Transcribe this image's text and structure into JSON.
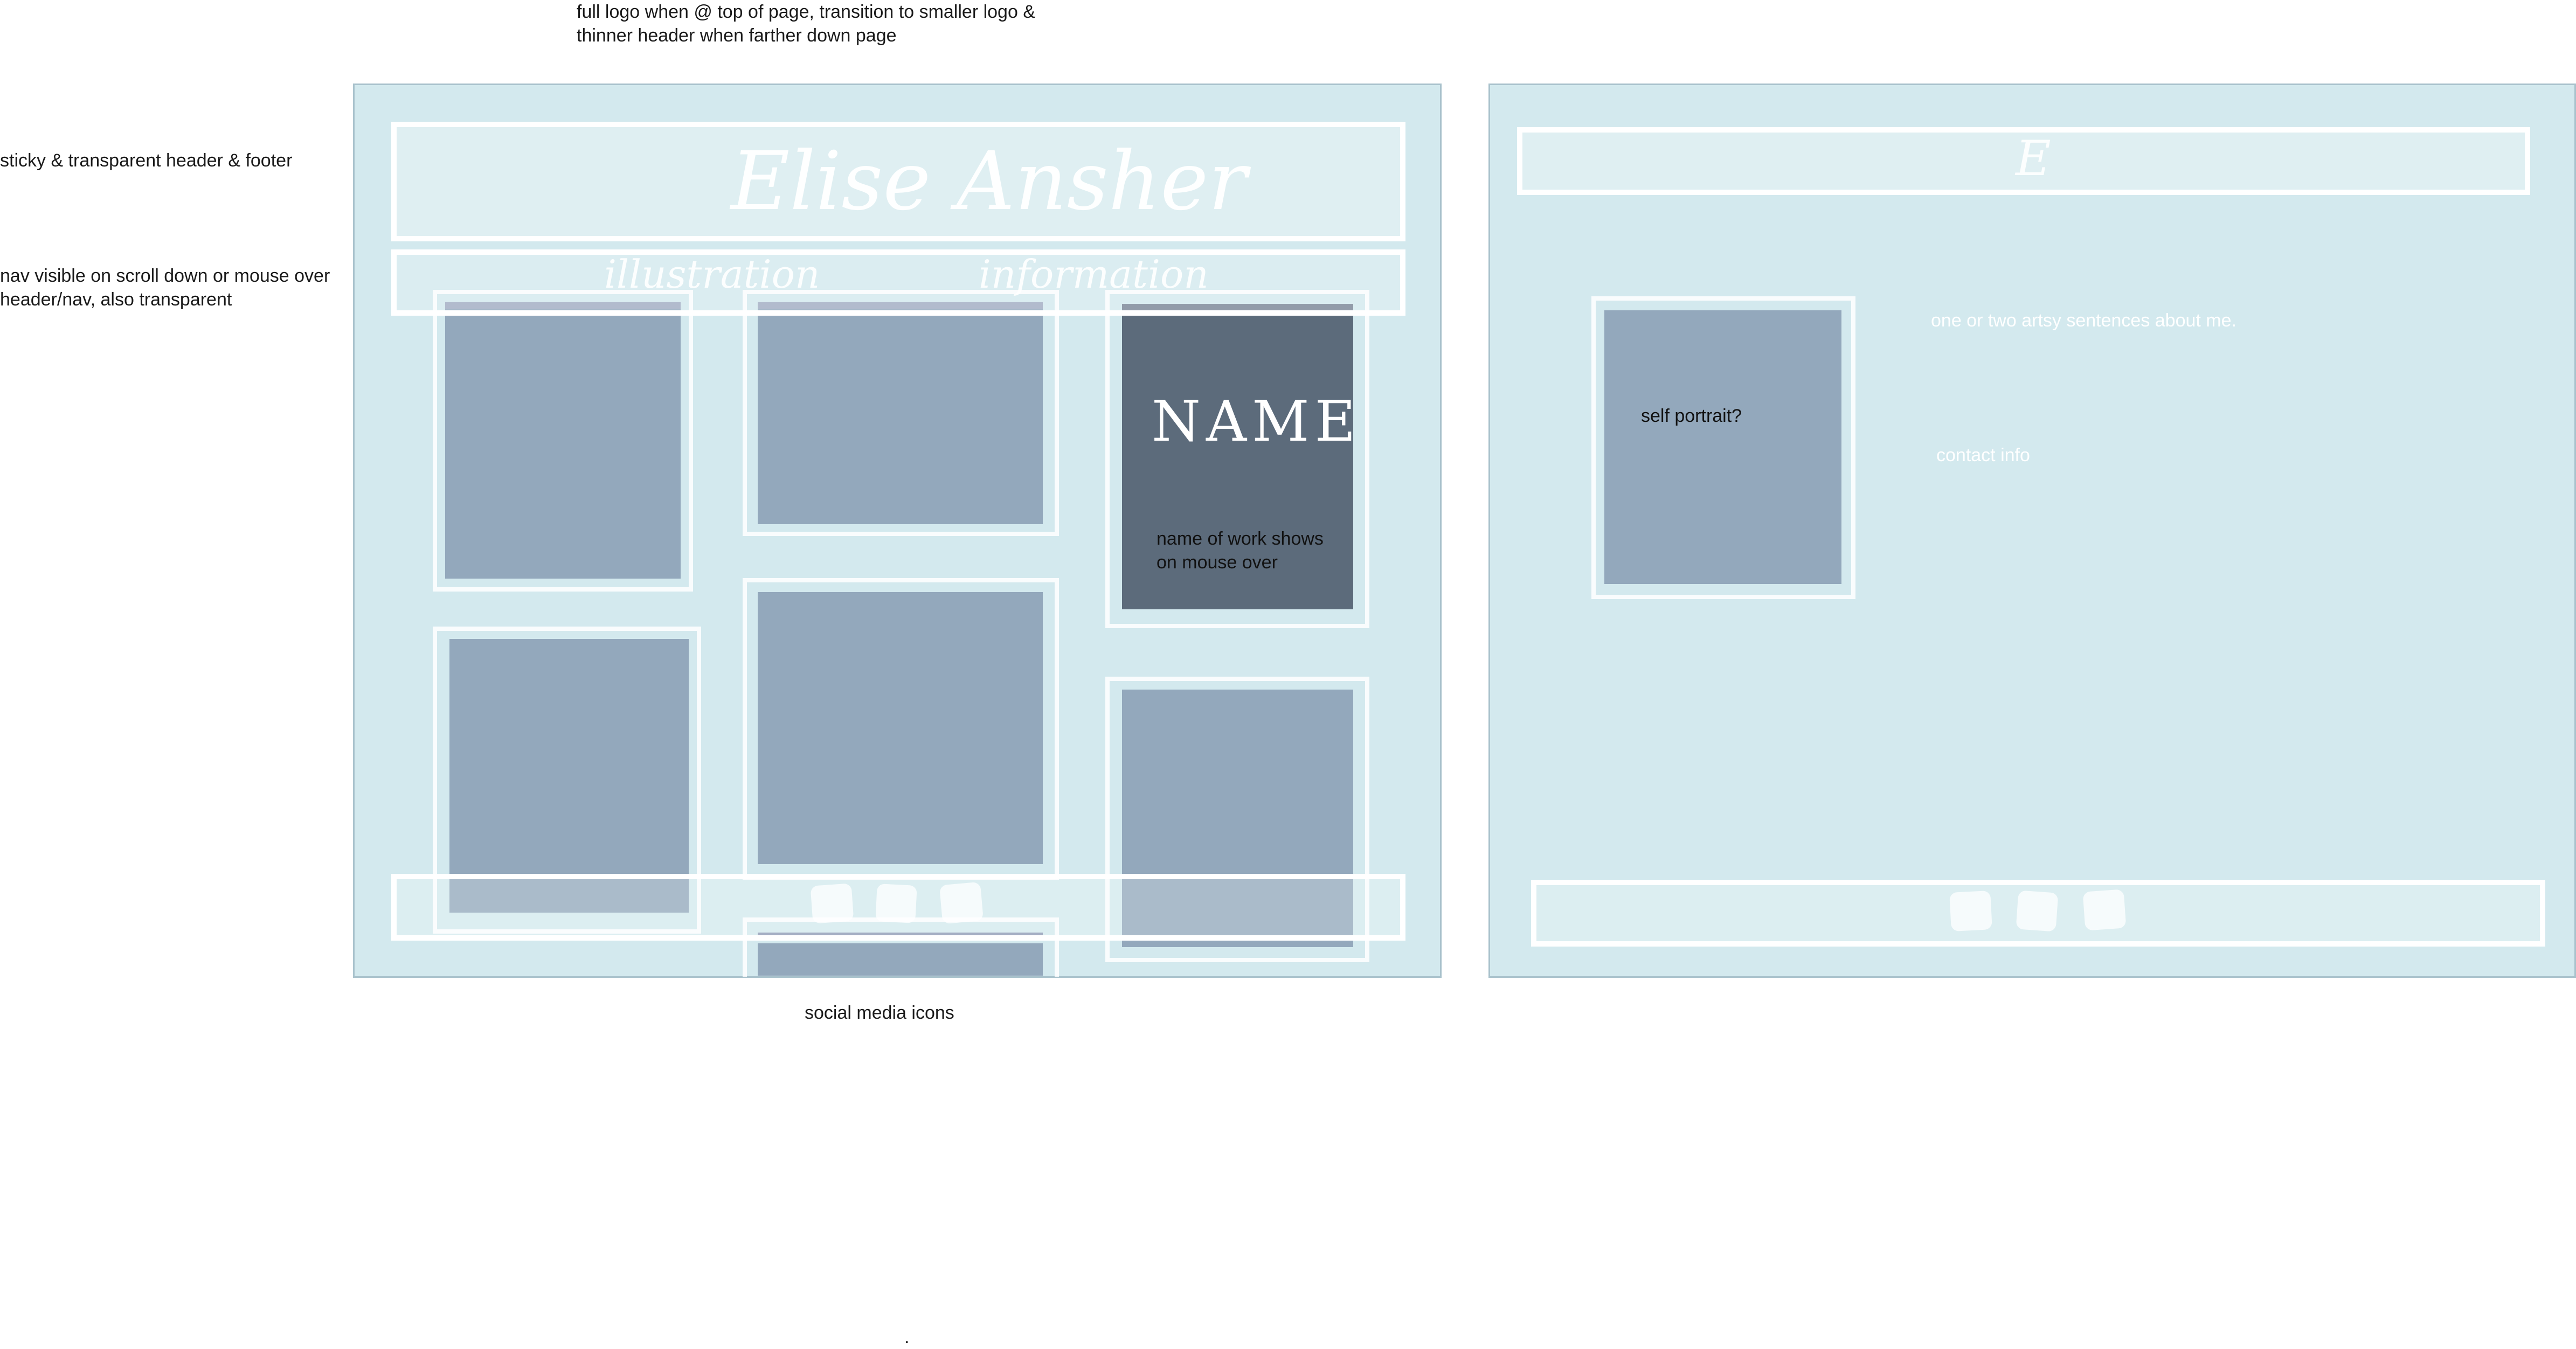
{
  "notes": {
    "logo_note": "full logo when @ top of page, transition to smaller logo &\nthinner header when farther down page",
    "sticky_note": "sticky & transparent header & footer",
    "nav_note": "nav visible on scroll down or mouse over\nheader/nav, also transparent",
    "social_note": "social media icons",
    "dot": "."
  },
  "gallery_page": {
    "logo_text": "Elise Ansher",
    "nav": [
      "illustration",
      "information"
    ],
    "hover_title": "NAME",
    "hover_caption": "name of work shows\non mouse over"
  },
  "info_page": {
    "logo_monogram": "E",
    "about_text": "one or two artsy sentences about me.",
    "portrait_label": "self portrait?",
    "contact_text": "contact info"
  },
  "colors": {
    "page_bg": "#d3e9ee",
    "tile": "#93a8bc",
    "tile_dark": "#5c6b7b",
    "frame": "#ffffff"
  }
}
